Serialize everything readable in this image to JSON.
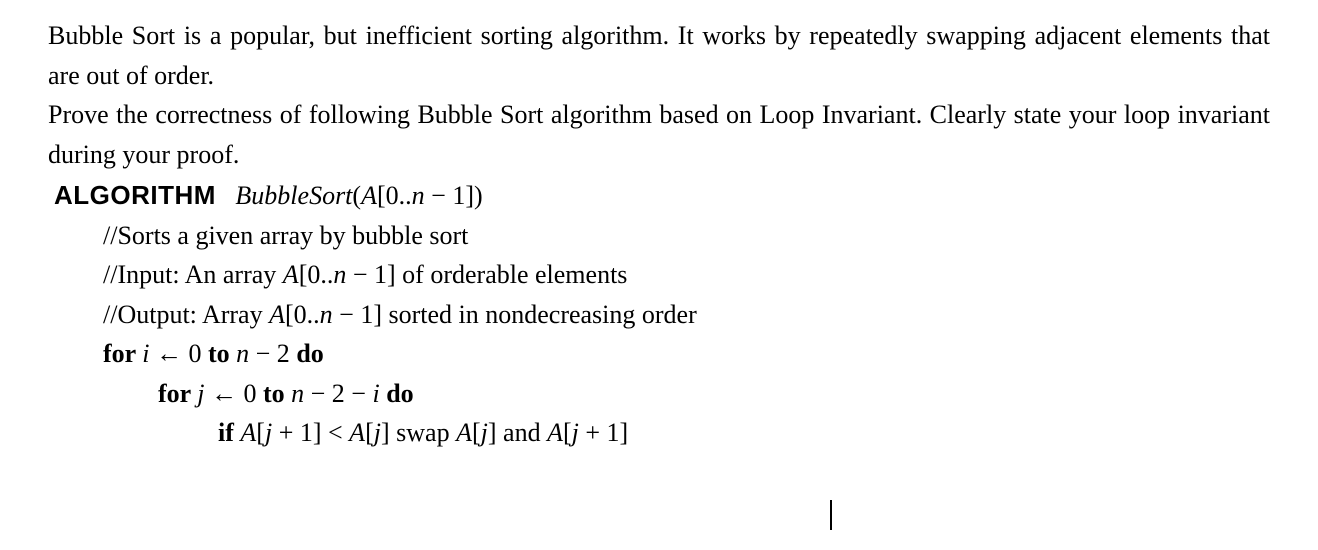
{
  "para1": "Bubble Sort is a popular, but inefficient sorting algorithm. It works by repeatedly swapping adjacent elements that are out of order.",
  "para2": "Prove the correctness of following Bubble Sort algorithm based on Loop Invariant. Clearly state your loop invariant during your proof.",
  "algo": {
    "kw_algorithm": "ALGORITHM",
    "gap": "   ",
    "name": "BubbleSort",
    "sig_open": "(",
    "sig_arr": "A",
    "sig_range": "[0..",
    "sig_n": "n",
    "sig_minus": " − 1])",
    "comment1": "//Sorts a given array by bubble sort",
    "comment2_a": "//Input: An array ",
    "comment2_arr": "A",
    "comment2_b": "[0..",
    "comment2_n": "n",
    "comment2_c": " − 1] of orderable elements",
    "comment3_a": "//Output: Array ",
    "comment3_arr": "A",
    "comment3_b": "[0..",
    "comment3_n": "n",
    "comment3_c": " − 1] sorted in nondecreasing order",
    "for_kw": "for ",
    "to_kw": " to ",
    "do_kw": " do",
    "if_kw": "if ",
    "outer_i": "i",
    "outer_assign": " ← 0",
    "outer_bound_n": "n",
    "outer_bound_tail": " − 2",
    "inner_j": "j",
    "inner_assign": " ← 0",
    "inner_bound_n": "n",
    "inner_bound_mid": " − 2 − ",
    "inner_bound_i": "i",
    "cond_A1": "A",
    "cond_open1": "[",
    "cond_j1": "j",
    "cond_plus1": " + 1] < ",
    "cond_A2": "A",
    "cond_open2": "[",
    "cond_j2": "j",
    "cond_close2": "]",
    "swap_txt": " swap ",
    "swap_A1": "A",
    "swap_open1": "[",
    "swap_j1": "j",
    "swap_close1": "]",
    "swap_and": " and ",
    "swap_A2": "A",
    "swap_open2": "[",
    "swap_j2": "j",
    "swap_plus": " + 1]"
  }
}
